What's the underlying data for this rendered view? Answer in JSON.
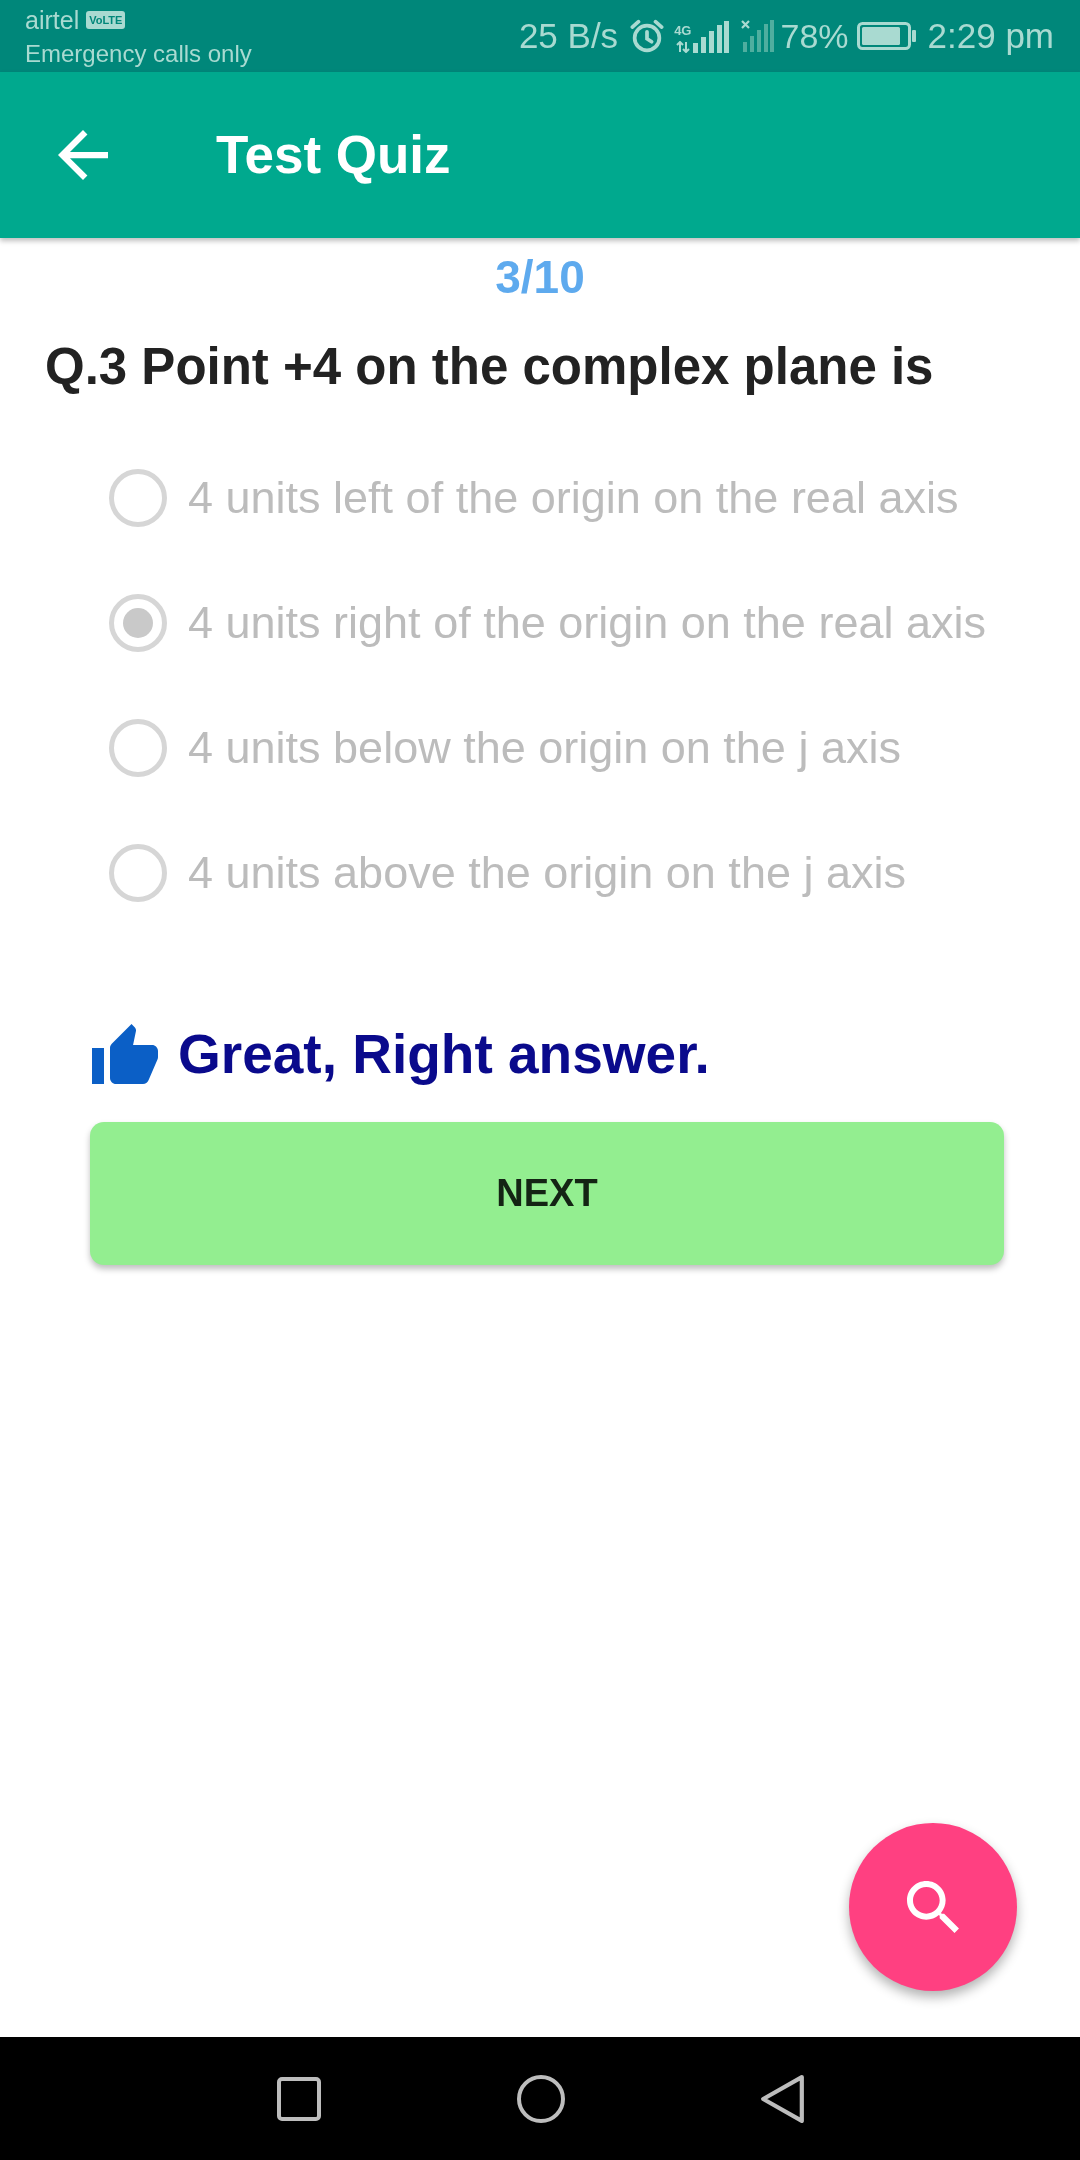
{
  "status_bar": {
    "carrier": "airtel",
    "carrier_badge": "VoLTE",
    "carrier_status": "Emergency calls only",
    "net_speed": "25 B/s",
    "network_type": "4G",
    "battery": "78%",
    "time": "2:29 pm"
  },
  "app_bar": {
    "title": "Test Quiz"
  },
  "quiz": {
    "progress": "3/10",
    "question": "Q.3 Point +4 on the complex plane is",
    "options": [
      {
        "label": "4 units left of the origin on the real axis",
        "selected": false,
        "disabled": true
      },
      {
        "label": "4 units right of the origin on the real axis",
        "selected": true,
        "disabled": true
      },
      {
        "label": "4 units below the origin on the j axis",
        "selected": false,
        "disabled": true
      },
      {
        "label": "4 units above the origin on the j axis",
        "selected": false,
        "disabled": true
      }
    ],
    "feedback": {
      "kind": "correct",
      "text": "Great, Right answer."
    },
    "next_button": {
      "label": "NEXT"
    }
  }
}
